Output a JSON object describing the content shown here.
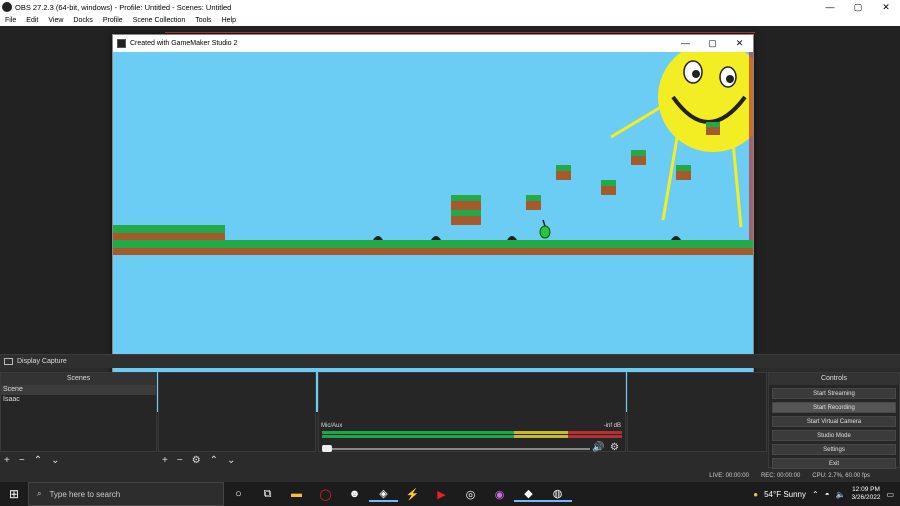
{
  "obs": {
    "title": "OBS 27.2.3 (64-bit, windows) - Profile: Untitled - Scenes: Untitled",
    "menu": [
      "File",
      "Edit",
      "View",
      "Docks",
      "Profile",
      "Scene Collection",
      "Tools",
      "Help"
    ],
    "window_controls": [
      "—",
      "▢",
      "✕"
    ]
  },
  "game": {
    "title": "Created with GameMaker Studio 2",
    "window_controls": [
      "—",
      "▢",
      "✕"
    ]
  },
  "source_bar": {
    "label": "Display Capture"
  },
  "scenes": {
    "header": "Scenes",
    "items": [
      "Scene",
      "Isaac"
    ],
    "selected": 0
  },
  "mixer": {
    "channel": "Mic/Aux",
    "level": "-inf dB",
    "scale": [
      "-60",
      "-55",
      "-50",
      "-45",
      "-40",
      "-35",
      "-30",
      "-25",
      "-20",
      "-15",
      "-10",
      "-5",
      "0"
    ]
  },
  "controls": {
    "header": "Controls",
    "buttons": [
      "Start Streaming",
      "Start Recording",
      "Start Virtual Camera",
      "Studio Mode",
      "Settings",
      "Exit"
    ]
  },
  "status": {
    "live": "LIVE: 00:00:00",
    "rec": "REC: 00:00:00",
    "cpu": "CPU: 2.7%, 60.00 fps"
  },
  "taskbar": {
    "search_placeholder": "Type here to search",
    "weather": "54°F  Sunny",
    "time": "12:09 PM",
    "date": "3/26/2022"
  }
}
